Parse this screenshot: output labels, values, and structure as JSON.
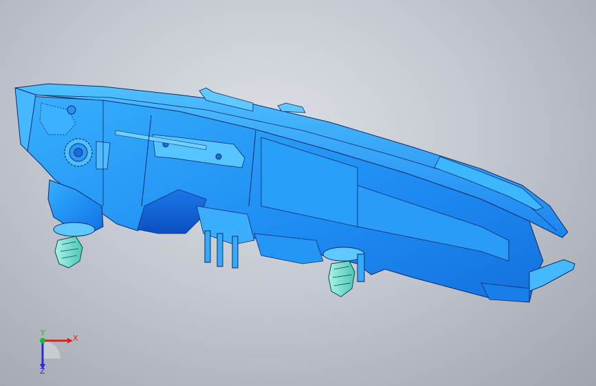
{
  "viewport": {
    "background_center": "#dcdfe5",
    "background_edge": "#9fa4ad"
  },
  "model": {
    "body_color": "#1e90ff",
    "highlight_color": "#5ec8ff",
    "shadow_color": "#0a56c8",
    "edge_color": "#0b2a66",
    "clip_color": "#7fe6d6"
  },
  "triad": {
    "x_label": "X",
    "y_label": "Y",
    "z_label": "Z",
    "x_color": "#e0201a",
    "y_color": "#1fb43c",
    "z_color": "#2a2ad8"
  }
}
